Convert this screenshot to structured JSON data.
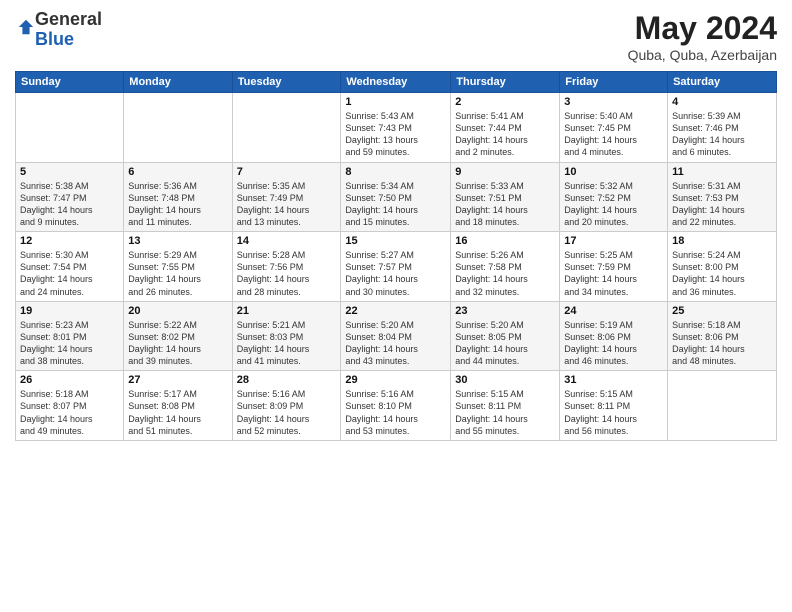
{
  "logo": {
    "general": "General",
    "blue": "Blue"
  },
  "title": "May 2024",
  "subtitle": "Quba, Quba, Azerbaijan",
  "days_of_week": [
    "Sunday",
    "Monday",
    "Tuesday",
    "Wednesday",
    "Thursday",
    "Friday",
    "Saturday"
  ],
  "weeks": [
    [
      {
        "day": "",
        "info": ""
      },
      {
        "day": "",
        "info": ""
      },
      {
        "day": "",
        "info": ""
      },
      {
        "day": "1",
        "info": "Sunrise: 5:43 AM\nSunset: 7:43 PM\nDaylight: 13 hours\nand 59 minutes."
      },
      {
        "day": "2",
        "info": "Sunrise: 5:41 AM\nSunset: 7:44 PM\nDaylight: 14 hours\nand 2 minutes."
      },
      {
        "day": "3",
        "info": "Sunrise: 5:40 AM\nSunset: 7:45 PM\nDaylight: 14 hours\nand 4 minutes."
      },
      {
        "day": "4",
        "info": "Sunrise: 5:39 AM\nSunset: 7:46 PM\nDaylight: 14 hours\nand 6 minutes."
      }
    ],
    [
      {
        "day": "5",
        "info": "Sunrise: 5:38 AM\nSunset: 7:47 PM\nDaylight: 14 hours\nand 9 minutes."
      },
      {
        "day": "6",
        "info": "Sunrise: 5:36 AM\nSunset: 7:48 PM\nDaylight: 14 hours\nand 11 minutes."
      },
      {
        "day": "7",
        "info": "Sunrise: 5:35 AM\nSunset: 7:49 PM\nDaylight: 14 hours\nand 13 minutes."
      },
      {
        "day": "8",
        "info": "Sunrise: 5:34 AM\nSunset: 7:50 PM\nDaylight: 14 hours\nand 15 minutes."
      },
      {
        "day": "9",
        "info": "Sunrise: 5:33 AM\nSunset: 7:51 PM\nDaylight: 14 hours\nand 18 minutes."
      },
      {
        "day": "10",
        "info": "Sunrise: 5:32 AM\nSunset: 7:52 PM\nDaylight: 14 hours\nand 20 minutes."
      },
      {
        "day": "11",
        "info": "Sunrise: 5:31 AM\nSunset: 7:53 PM\nDaylight: 14 hours\nand 22 minutes."
      }
    ],
    [
      {
        "day": "12",
        "info": "Sunrise: 5:30 AM\nSunset: 7:54 PM\nDaylight: 14 hours\nand 24 minutes."
      },
      {
        "day": "13",
        "info": "Sunrise: 5:29 AM\nSunset: 7:55 PM\nDaylight: 14 hours\nand 26 minutes."
      },
      {
        "day": "14",
        "info": "Sunrise: 5:28 AM\nSunset: 7:56 PM\nDaylight: 14 hours\nand 28 minutes."
      },
      {
        "day": "15",
        "info": "Sunrise: 5:27 AM\nSunset: 7:57 PM\nDaylight: 14 hours\nand 30 minutes."
      },
      {
        "day": "16",
        "info": "Sunrise: 5:26 AM\nSunset: 7:58 PM\nDaylight: 14 hours\nand 32 minutes."
      },
      {
        "day": "17",
        "info": "Sunrise: 5:25 AM\nSunset: 7:59 PM\nDaylight: 14 hours\nand 34 minutes."
      },
      {
        "day": "18",
        "info": "Sunrise: 5:24 AM\nSunset: 8:00 PM\nDaylight: 14 hours\nand 36 minutes."
      }
    ],
    [
      {
        "day": "19",
        "info": "Sunrise: 5:23 AM\nSunset: 8:01 PM\nDaylight: 14 hours\nand 38 minutes."
      },
      {
        "day": "20",
        "info": "Sunrise: 5:22 AM\nSunset: 8:02 PM\nDaylight: 14 hours\nand 39 minutes."
      },
      {
        "day": "21",
        "info": "Sunrise: 5:21 AM\nSunset: 8:03 PM\nDaylight: 14 hours\nand 41 minutes."
      },
      {
        "day": "22",
        "info": "Sunrise: 5:20 AM\nSunset: 8:04 PM\nDaylight: 14 hours\nand 43 minutes."
      },
      {
        "day": "23",
        "info": "Sunrise: 5:20 AM\nSunset: 8:05 PM\nDaylight: 14 hours\nand 44 minutes."
      },
      {
        "day": "24",
        "info": "Sunrise: 5:19 AM\nSunset: 8:06 PM\nDaylight: 14 hours\nand 46 minutes."
      },
      {
        "day": "25",
        "info": "Sunrise: 5:18 AM\nSunset: 8:06 PM\nDaylight: 14 hours\nand 48 minutes."
      }
    ],
    [
      {
        "day": "26",
        "info": "Sunrise: 5:18 AM\nSunset: 8:07 PM\nDaylight: 14 hours\nand 49 minutes."
      },
      {
        "day": "27",
        "info": "Sunrise: 5:17 AM\nSunset: 8:08 PM\nDaylight: 14 hours\nand 51 minutes."
      },
      {
        "day": "28",
        "info": "Sunrise: 5:16 AM\nSunset: 8:09 PM\nDaylight: 14 hours\nand 52 minutes."
      },
      {
        "day": "29",
        "info": "Sunrise: 5:16 AM\nSunset: 8:10 PM\nDaylight: 14 hours\nand 53 minutes."
      },
      {
        "day": "30",
        "info": "Sunrise: 5:15 AM\nSunset: 8:11 PM\nDaylight: 14 hours\nand 55 minutes."
      },
      {
        "day": "31",
        "info": "Sunrise: 5:15 AM\nSunset: 8:11 PM\nDaylight: 14 hours\nand 56 minutes."
      },
      {
        "day": "",
        "info": ""
      }
    ]
  ]
}
